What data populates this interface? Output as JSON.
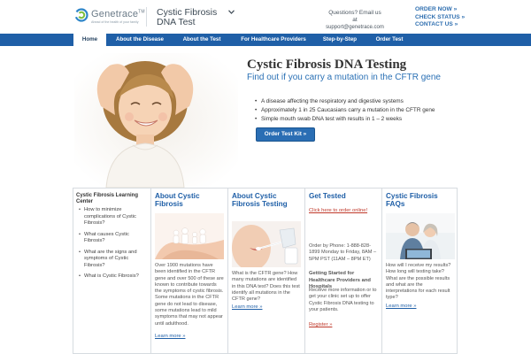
{
  "header": {
    "logo_name": "Genetrace",
    "logo_trademark": "TM",
    "logo_tagline": "Ahead of the health of your family",
    "product": "Cystic Fibrosis DNA Test",
    "contact_line": "Questions? Email us at",
    "contact_email": "support@genetrace.com",
    "quick_links": [
      "ORDER NOW »",
      "CHECK STATUS »",
      "CONTACT US »"
    ]
  },
  "nav": {
    "items": [
      "Home",
      "About the Disease",
      "About the Test",
      "For Healthcare Providers",
      "Step-by-Step",
      "Order Test"
    ],
    "active": "Home"
  },
  "hero": {
    "title": "Cystic Fibrosis DNA Testing",
    "subtitle": "Find out if you carry a mutation in the CFTR gene",
    "bullets": [
      "A disease affecting the respiratory and digestive systems",
      "Approximately 1 in 25 Caucasians carry a mutation in the CFTR gene",
      "Simple mouth swab DNA test with results in 1 – 2 weeks"
    ],
    "order_button": "Order Test Kit »"
  },
  "learning_center": {
    "title": "Cystic Fibrosis Learning Center",
    "items": [
      "How to minimize complications of Cystic Fibrosis?",
      "What causes Cystic Fibrosis?",
      "What are the signs and symptoms of Cystic Fibrosis?",
      "What is Cystic Fibrosis?"
    ]
  },
  "about_cf": {
    "title": "About Cystic Fibrosis",
    "text": "Over 1900 mutations have been identified in the CFTR gene and over 500 of these are known to contribute towards the symptoms of cystic fibrosis. Some mutations in the CFTR gene do not lead to disease, some mutations lead to mild symptoms that may not appear until adulthood.",
    "link": "Learn more »"
  },
  "about_test": {
    "title": "About Cystic Fibrosis Testing",
    "text": "What is the CFTR gene? How many mutations are identified in this DNA test? Does this test identify all mutations in the CFTR gene?",
    "link": "Learn more »"
  },
  "get_tested": {
    "title": "Get Tested",
    "order_link": "Click here to order online!",
    "phone": "Order by Phone: 1-888-828-1899 Monday to Friday, 8AM – 5PM PST (11AM – 8PM ET)",
    "subheading": "Getting Started for Healthcare Providers and Hospitals",
    "text": "Receive more information or to get your clinic set up to offer Cystic Fibrosis DNA testing to your patients.",
    "register": "Register »"
  },
  "faqs": {
    "title": "Cystic Fibrosis FAQs",
    "text": "How will I receive my results? How long will testing take? What are the possible results and what are the interpretations for each result type?",
    "link": "Learn more »"
  },
  "colors": {
    "brand_blue": "#1f5fa7",
    "link_blue": "#2a70b5",
    "link_red": "#c0392b"
  }
}
